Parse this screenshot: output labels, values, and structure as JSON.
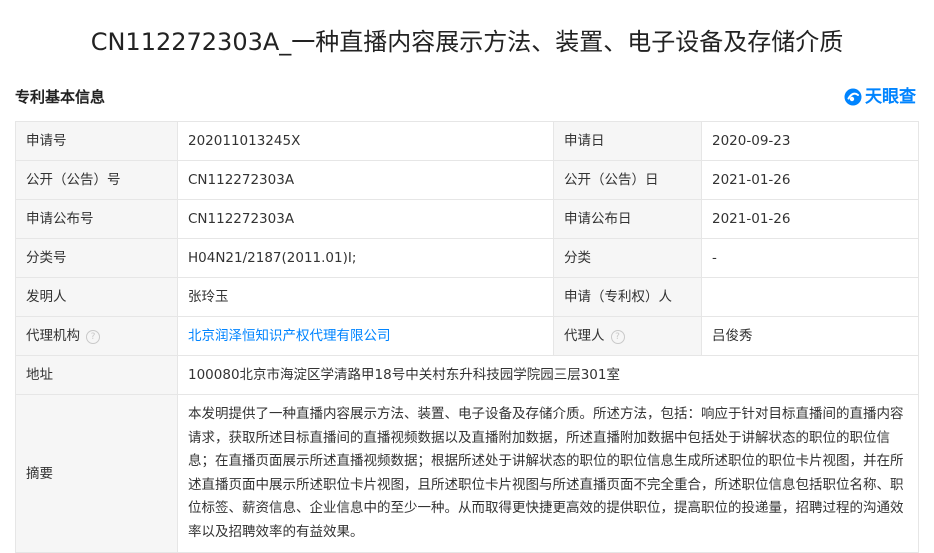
{
  "page_title": "CN112272303A_一种直播内容展示方法、装置、电子设备及存储介质",
  "section": {
    "title": "专利基本信息",
    "brand": "天眼查",
    "brand_color": "#0084ff"
  },
  "fields": {
    "application_no_label": "申请号",
    "application_no": "202011013245X",
    "application_date_label": "申请日",
    "application_date": "2020-09-23",
    "publication_no_label": "公开（公告）号",
    "publication_no": "CN112272303A",
    "publication_date_label": "公开（公告）日",
    "publication_date": "2021-01-26",
    "app_pub_no_label": "申请公布号",
    "app_pub_no": "CN112272303A",
    "app_pub_date_label": "申请公布日",
    "app_pub_date": "2021-01-26",
    "classification_label": "分类号",
    "classification": "H04N21/2187(2011.01)I;",
    "category_label": "分类",
    "category": "-",
    "inventor_label": "发明人",
    "inventor": "张玲玉",
    "applicant_label": "申请（专利权）人",
    "applicant": "",
    "agency_label": "代理机构",
    "agency": "北京润泽恒知识产权代理有限公司",
    "agent_label": "代理人",
    "agent": "吕俊秀",
    "address_label": "地址",
    "address": "100080北京市海淀区学清路甲18号中关村东升科技园学院园三层301室",
    "abstract_label": "摘要",
    "abstract": "本发明提供了一种直播内容展示方法、装置、电子设备及存储介质。所述方法，包括：响应于针对目标直播间的直播内容请求，获取所述目标直播间的直播视频数据以及直播附加数据，所述直播附加数据中包括处于讲解状态的职位的职位信息；在直播页面展示所述直播视频数据；根据所述处于讲解状态的职位的职位信息生成所述职位的职位卡片视图，并在所述直播页面中展示所述职位卡片视图，且所述职位卡片视图与所述直播页面不完全重合，所述职位信息包括职位名称、职位标签、薪资信息、企业信息中的至少一种。从而取得更快捷更高效的提供职位，提高职位的投递量，招聘过程的沟通效率以及招聘效率的有益效果。"
  },
  "help_glyph": "?"
}
